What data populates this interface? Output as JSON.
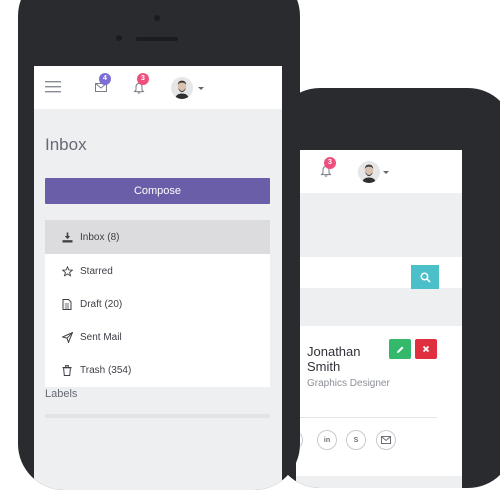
{
  "front": {
    "badges": {
      "mail": "4",
      "bell": "3"
    },
    "title": "Inbox",
    "compose_label": "Compose",
    "menu": [
      {
        "label": "Inbox (8)",
        "icon": "download-icon",
        "active": true
      },
      {
        "label": "Starred",
        "icon": "star-icon"
      },
      {
        "label": "Draft (20)",
        "icon": "file-icon"
      },
      {
        "label": "Sent Mail",
        "icon": "send-icon"
      },
      {
        "label": "Trash (354)",
        "icon": "trash-icon"
      }
    ],
    "labels_heading": "Labels"
  },
  "back": {
    "badges": {
      "bell": "3"
    },
    "profile": {
      "first": "Jonathan",
      "last": "Smith",
      "role": "Graphics Designer"
    },
    "social": [
      "in",
      "S"
    ]
  },
  "colors": {
    "accent": "#6a5ea8",
    "badge_mail": "#7b6fd6",
    "badge_bell": "#ef4f7c",
    "teal": "#4cc0c9",
    "green": "#33b86c",
    "red": "#e0303f"
  }
}
